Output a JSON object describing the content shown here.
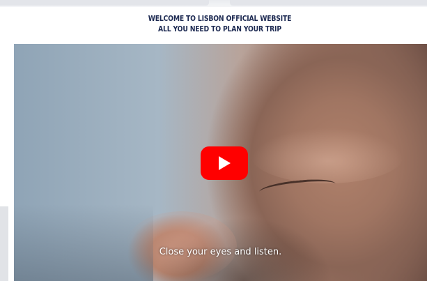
{
  "header": {
    "line1": "WELCOME TO LISBON OFFICIAL WEBSITE",
    "line2": "ALL YOU NEED TO PLAN YOUR TRIP"
  },
  "video": {
    "caption": "Close your eyes and listen.",
    "play_icon": "play-icon",
    "play_button_color": "#ff0000"
  },
  "colors": {
    "header_text": "#1d2a52"
  }
}
